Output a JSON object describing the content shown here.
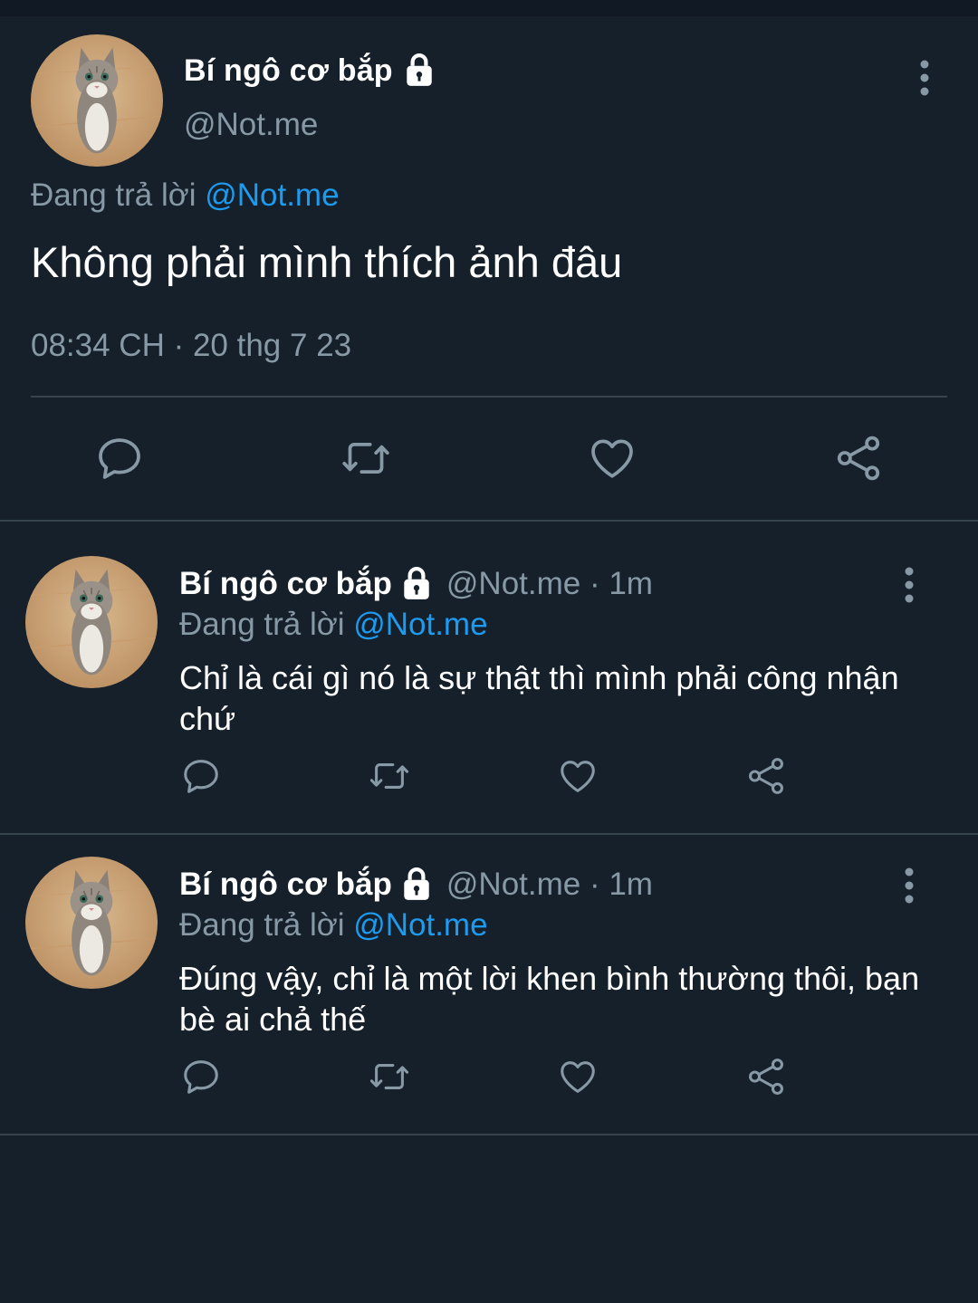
{
  "main_tweet": {
    "author_name": "Bí ngô cơ bắp",
    "handle": "@Not.me",
    "replying_to_prefix": "Đang trả lời",
    "replying_to_handle": "@Not.me",
    "text": "Không phải mình thích ảnh đâu",
    "timestamp": "08:34 CH · 20 thg 7 23",
    "actions": [
      "reply-icon",
      "retweet-icon",
      "like-icon",
      "share-icon"
    ]
  },
  "replies": [
    {
      "author_name": "Bí ngô cơ bắp",
      "handle_time": "@Not.me · 1m",
      "replying_to_prefix": "Đang trả lời",
      "replying_to_handle": "@Not.me",
      "text": "Chỉ là cái gì nó là sự thật thì mình phải công nhận chứ"
    },
    {
      "author_name": "Bí ngô cơ bắp",
      "handle_time": "@Not.me · 1m",
      "replying_to_prefix": "Đang trả lời",
      "replying_to_handle": "@Not.me",
      "text": "Đúng vậy, chỉ là một lời khen bình thường thôi, bạn bè ai chả thế"
    }
  ],
  "colors": {
    "background": "#15202b",
    "text_primary": "#ffffff",
    "text_secondary": "#8899a6",
    "accent": "#1d9bf0",
    "divider": "#38444d"
  }
}
